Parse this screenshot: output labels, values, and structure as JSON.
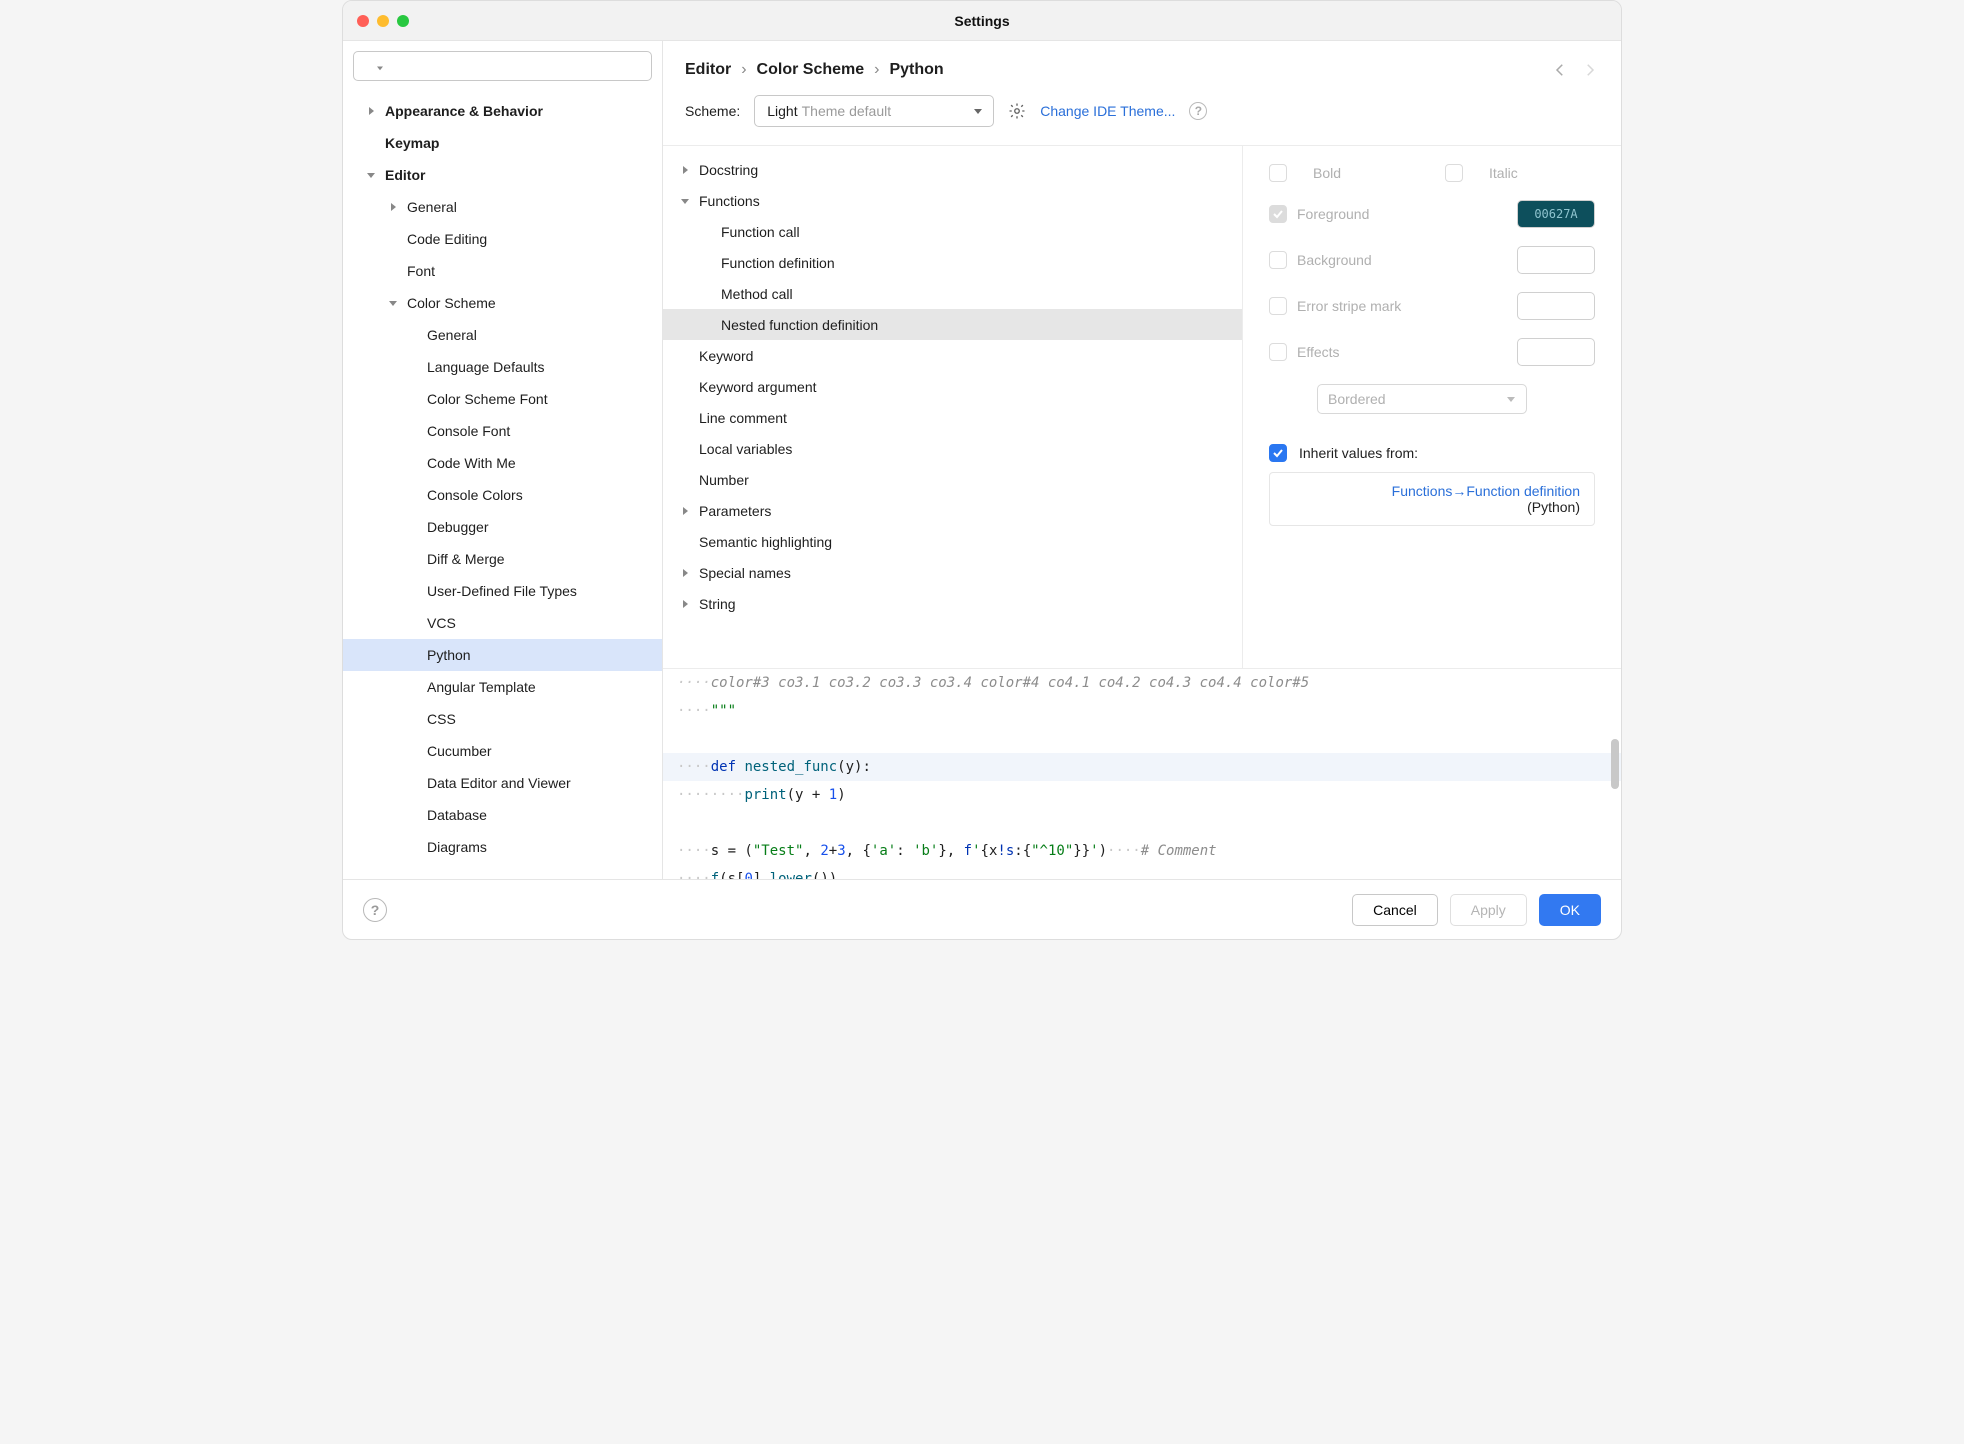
{
  "window": {
    "title": "Settings"
  },
  "search": {
    "placeholder": ""
  },
  "sidebar": [
    {
      "label": "Appearance & Behavior",
      "lvl": 1,
      "bold": true,
      "chev": "right"
    },
    {
      "label": "Keymap",
      "lvl": 1,
      "bold": true,
      "nochev": true
    },
    {
      "label": "Editor",
      "lvl": 1,
      "bold": true,
      "chev": "down"
    },
    {
      "label": "General",
      "lvl": 2,
      "chev": "right"
    },
    {
      "label": "Code Editing",
      "lvl": 2,
      "nochev": true
    },
    {
      "label": "Font",
      "lvl": 2,
      "nochev": true
    },
    {
      "label": "Color Scheme",
      "lvl": 2,
      "chev": "down"
    },
    {
      "label": "General",
      "lvl": 3,
      "nochev": true
    },
    {
      "label": "Language Defaults",
      "lvl": 3,
      "nochev": true
    },
    {
      "label": "Color Scheme Font",
      "lvl": 3,
      "nochev": true
    },
    {
      "label": "Console Font",
      "lvl": 3,
      "nochev": true
    },
    {
      "label": "Code With Me",
      "lvl": 3,
      "nochev": true
    },
    {
      "label": "Console Colors",
      "lvl": 3,
      "nochev": true
    },
    {
      "label": "Debugger",
      "lvl": 3,
      "nochev": true
    },
    {
      "label": "Diff & Merge",
      "lvl": 3,
      "nochev": true
    },
    {
      "label": "User-Defined File Types",
      "lvl": 3,
      "nochev": true
    },
    {
      "label": "VCS",
      "lvl": 3,
      "nochev": true
    },
    {
      "label": "Python",
      "lvl": 3,
      "nochev": true,
      "selected": true
    },
    {
      "label": "Angular Template",
      "lvl": 3,
      "nochev": true
    },
    {
      "label": "CSS",
      "lvl": 3,
      "nochev": true
    },
    {
      "label": "Cucumber",
      "lvl": 3,
      "nochev": true
    },
    {
      "label": "Data Editor and Viewer",
      "lvl": 3,
      "nochev": true
    },
    {
      "label": "Database",
      "lvl": 3,
      "nochev": true
    },
    {
      "label": "Diagrams",
      "lvl": 3,
      "nochev": true
    }
  ],
  "breadcrumbs": [
    "Editor",
    "Color Scheme",
    "Python"
  ],
  "scheme": {
    "label": "Scheme:",
    "value": "Light",
    "suffix": "Theme default",
    "change_link": "Change IDE Theme..."
  },
  "attrs": [
    {
      "label": "Docstring",
      "lvl": 1,
      "chev": "right"
    },
    {
      "label": "Functions",
      "lvl": 1,
      "chev": "down"
    },
    {
      "label": "Function call",
      "lvl": 2,
      "nochev": true
    },
    {
      "label": "Function definition",
      "lvl": 2,
      "nochev": true
    },
    {
      "label": "Method call",
      "lvl": 2,
      "nochev": true
    },
    {
      "label": "Nested function definition",
      "lvl": 2,
      "nochev": true,
      "selected": true
    },
    {
      "label": "Keyword",
      "lvl": 1,
      "nochev": true
    },
    {
      "label": "Keyword argument",
      "lvl": 1,
      "nochev": true
    },
    {
      "label": "Line comment",
      "lvl": 1,
      "nochev": true
    },
    {
      "label": "Local variables",
      "lvl": 1,
      "nochev": true
    },
    {
      "label": "Number",
      "lvl": 1,
      "nochev": true
    },
    {
      "label": "Parameters",
      "lvl": 1,
      "chev": "right"
    },
    {
      "label": "Semantic highlighting",
      "lvl": 1,
      "nochev": true
    },
    {
      "label": "Special names",
      "lvl": 1,
      "chev": "right"
    },
    {
      "label": "String",
      "lvl": 1,
      "chev": "right"
    }
  ],
  "style": {
    "bold": "Bold",
    "italic": "Italic",
    "foreground": "Foreground",
    "fg_hex": "00627A",
    "background": "Background",
    "errstripe": "Error stripe mark",
    "effects": "Effects",
    "effects_type": "Bordered",
    "inherit_label": "Inherit values from:",
    "inherit_link": "Functions→Function definition",
    "inherit_sub": "(Python)"
  },
  "footer": {
    "cancel": "Cancel",
    "apply": "Apply",
    "ok": "OK"
  }
}
